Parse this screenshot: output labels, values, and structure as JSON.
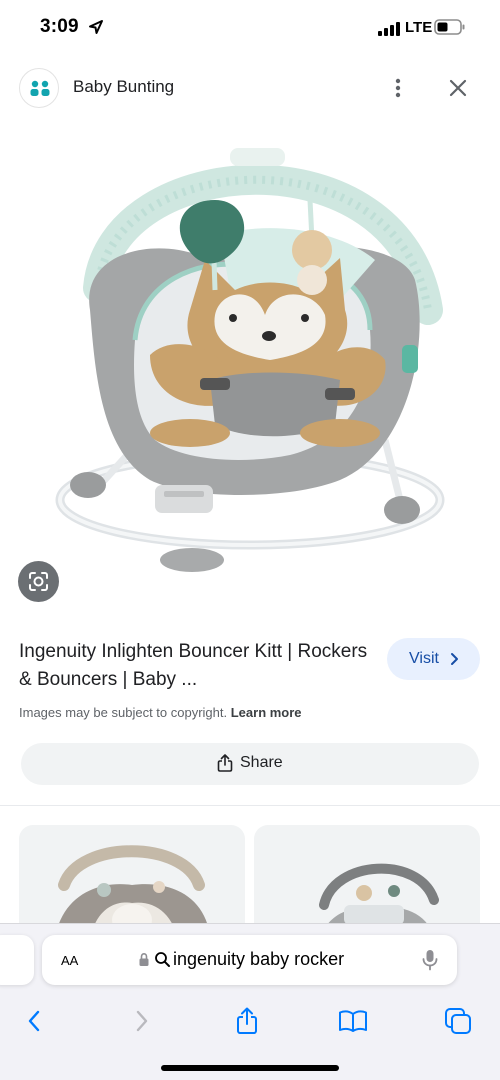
{
  "status_bar": {
    "time": "3:09",
    "network": "LTE"
  },
  "source": {
    "name": "Baby Bunting"
  },
  "result": {
    "title": "Ingenuity Inlighten Bouncer Kitt | Rockers & Bouncers | Baby ...",
    "visit_label": "Visit",
    "copyright_text": "Images may be subject to copyright.",
    "learn_more_label": "Learn more",
    "share_label": "Share"
  },
  "safari": {
    "aa_label": "AA",
    "address_text": "ingenuity baby rocker"
  },
  "icons": {
    "location": "location-arrow-icon",
    "signal": "signal-icon",
    "battery": "battery-icon",
    "more": "more-vert-icon",
    "close": "close-icon",
    "lens": "lens-icon",
    "visit_chevron": "chevron-right-icon",
    "share": "share-icon",
    "lock": "lock-icon",
    "search": "search-icon",
    "mic": "mic-icon",
    "back": "back-icon",
    "forward": "forward-icon",
    "safari_share": "share-icon",
    "bookmarks": "bookmarks-icon",
    "tabs": "tabs-icon"
  },
  "colors": {
    "accent_blue": "#1a73e8",
    "visit_bg": "#e8f0fe",
    "safari_blue": "#007aff",
    "source_logo": "#12a4af"
  }
}
